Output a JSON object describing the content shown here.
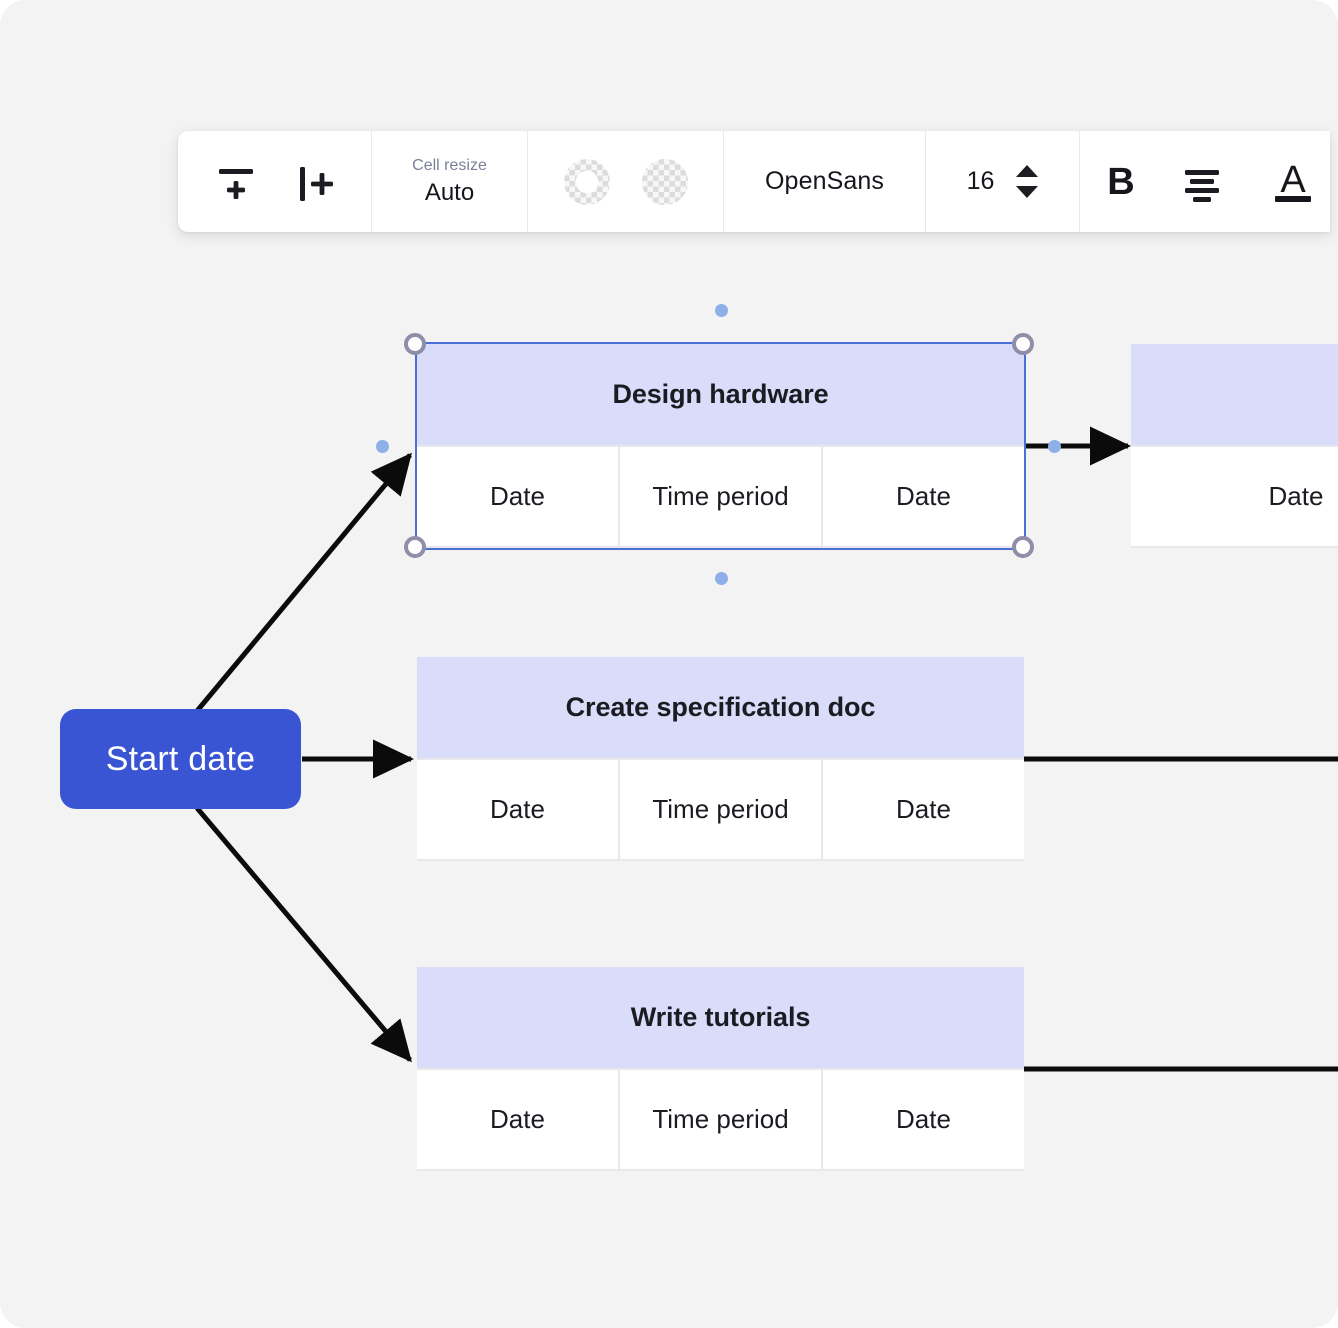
{
  "app": {
    "canvas_background": "#f3f3f3",
    "accent_color": "#3a55d3",
    "node_header_color": "#d9ddf9",
    "selection_color": "#4a70d6"
  },
  "toolbar": {
    "groups": [
      {
        "name": "table-buttons",
        "buttons": [
          {
            "icon": "add-row-icon",
            "label": "Add row"
          },
          {
            "icon": "add-column-icon",
            "label": "Add column"
          }
        ]
      },
      {
        "name": "cell-resize",
        "label": "Cell resize",
        "value": "Auto"
      },
      {
        "name": "color-swatches",
        "swatches": [
          {
            "icon": "border-color-swatch",
            "value": "transparent"
          },
          {
            "icon": "fill-color-swatch",
            "value": "transparent"
          }
        ]
      },
      {
        "name": "font-family",
        "value": "OpenSans"
      },
      {
        "name": "font-size",
        "value": "16",
        "stepper": {
          "up": "increase-font-size",
          "down": "decrease-font-size"
        }
      },
      {
        "name": "text-format",
        "buttons": [
          {
            "icon": "bold-icon",
            "label": "B"
          },
          {
            "icon": "align-center-icon",
            "label": "Align center"
          },
          {
            "icon": "text-color-icon",
            "label": "A"
          }
        ]
      }
    ]
  },
  "diagram": {
    "start_node": {
      "label": "Start date"
    },
    "cells": {
      "date": "Date",
      "time_period": "Time period"
    },
    "nodes": [
      {
        "id": "design-hardware",
        "title": "Design hardware",
        "selected": true,
        "cells": [
          "Date",
          "Time period",
          "Date"
        ]
      },
      {
        "id": "create-specification-doc",
        "title": "Create specification doc",
        "selected": false,
        "cells": [
          "Date",
          "Time period",
          "Date"
        ]
      },
      {
        "id": "write-tutorials",
        "title": "Write tutorials",
        "selected": false,
        "cells": [
          "Date",
          "Time period",
          "Date"
        ]
      },
      {
        "id": "offscreen-right",
        "title": "",
        "selected": false,
        "cells": [
          "Date"
        ]
      }
    ]
  }
}
